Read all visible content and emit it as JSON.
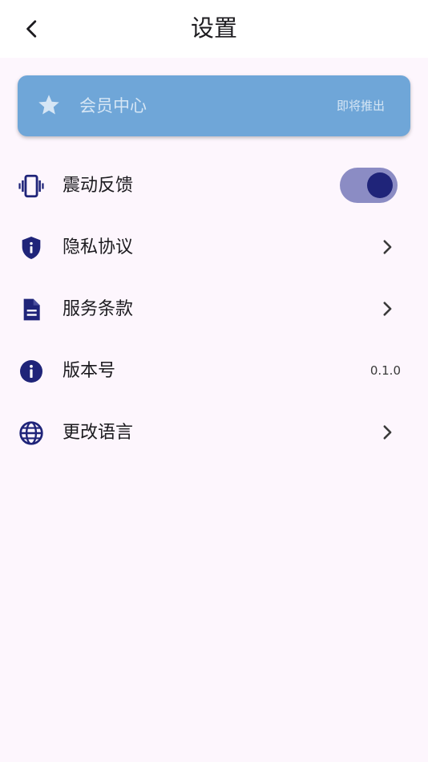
{
  "header": {
    "title": "设置",
    "back_icon": "back-arrow-icon"
  },
  "member_card": {
    "label": "会员中心",
    "badge": "即将推出",
    "icon": "star-icon",
    "background": "#6fa6d8"
  },
  "settings": {
    "vibration": {
      "label": "震动反馈",
      "icon": "vibration-icon",
      "enabled": true
    },
    "privacy": {
      "label": "隐私协议",
      "icon": "shield-icon"
    },
    "terms": {
      "label": "服务条款",
      "icon": "document-icon"
    },
    "version": {
      "label": "版本号",
      "icon": "info-icon",
      "value": "0.1.0"
    },
    "language": {
      "label": "更改语言",
      "icon": "globe-icon"
    }
  },
  "colors": {
    "accent": "#1f2479",
    "toggle_track": "#8b8cc4",
    "background": "#fdf6fd"
  }
}
